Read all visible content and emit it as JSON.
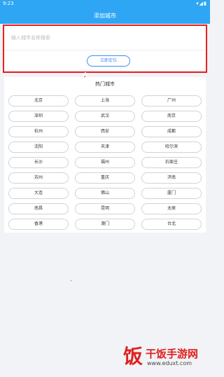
{
  "status_bar": {
    "time": "9:23",
    "icons": "▾◢▮"
  },
  "app_bar": {
    "title": "添加城市"
  },
  "search": {
    "placeholder": "输入城市名称搜索",
    "locate_label": "立即定位"
  },
  "hot_cities": {
    "title": "热门城市",
    "items": [
      "北京",
      "上海",
      "广州",
      "深圳",
      "武汉",
      "南京",
      "杭州",
      "西安",
      "成都",
      "沈阳",
      "天津",
      "哈尔滨",
      "长沙",
      "福州",
      "石家庄",
      "苏州",
      "重庆",
      "济南",
      "大连",
      "佛山",
      "厦门",
      "南昌",
      "昆明",
      "太原",
      "香港",
      "澳门",
      "台北"
    ]
  },
  "watermark": {
    "logo": "饭",
    "name": "干饭手游网",
    "url": "www.eduxt.com"
  },
  "colors": {
    "header": "#2fa6f4",
    "accent": "#3c8df0",
    "annotation": "#ea1f1f"
  }
}
